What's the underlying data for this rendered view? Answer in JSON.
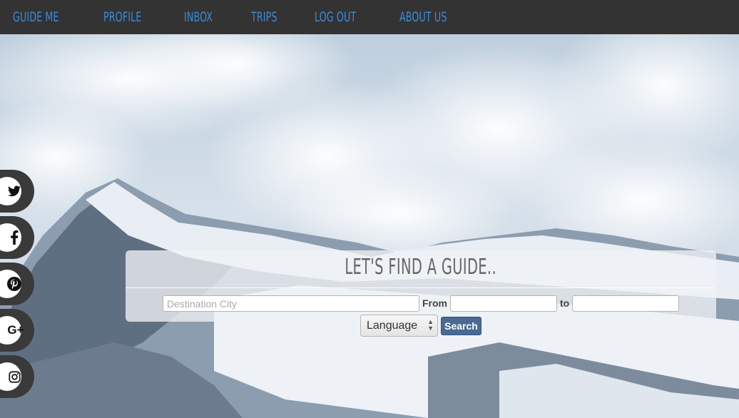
{
  "nav": {
    "items": [
      {
        "label": "GUIDE ME"
      },
      {
        "label": "PROFILE"
      },
      {
        "label": "INBOX"
      },
      {
        "label": "TRIPS"
      },
      {
        "label": "LOG OUT"
      },
      {
        "label": "ABOUT US"
      }
    ]
  },
  "social": [
    {
      "icon": "twitter-icon",
      "glyph": "🐦"
    },
    {
      "icon": "facebook-icon",
      "glyph": "f"
    },
    {
      "icon": "pinterest-icon",
      "glyph": "P"
    },
    {
      "icon": "google-plus-icon",
      "glyph": "G+"
    },
    {
      "icon": "instagram-icon",
      "glyph": "◎"
    }
  ],
  "search": {
    "title": "LET'S FIND A GUIDE..",
    "destination_placeholder": "Destination City",
    "from_label": "From",
    "to_label": "to",
    "language_value": "Language",
    "search_label": "Search"
  },
  "colors": {
    "nav_bg": "#333333",
    "nav_link": "#3e8bd6",
    "search_button": "#4a6a94"
  }
}
